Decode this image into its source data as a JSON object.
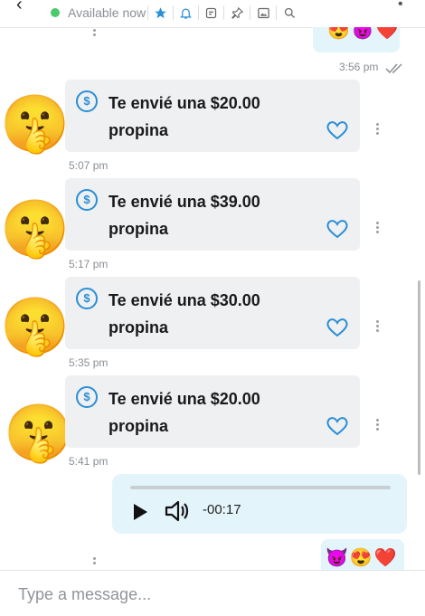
{
  "header": {
    "status": "Available now",
    "tools": [
      "star-icon",
      "bell-icon",
      "note-icon",
      "pin-icon",
      "image-icon",
      "search-icon"
    ],
    "status_color": "#4cc96a"
  },
  "chat": {
    "top_outgoing": {
      "emojis": "😍😈❤️",
      "time": "3:56 pm"
    },
    "tips": [
      {
        "text": "Te envié una $20.00 propina",
        "time": "5:07 pm",
        "avatar": "🤫"
      },
      {
        "text": "Te envié una $39.00 propina",
        "time": "5:17 pm",
        "avatar": "🤫"
      },
      {
        "text": "Te envié una $30.00 propina",
        "time": "5:35 pm",
        "avatar": "🤫"
      },
      {
        "text": "Te envié una $20.00 propina",
        "time": "5:41 pm",
        "avatar": "🤫"
      }
    ],
    "audio": {
      "duration": "-00:17"
    },
    "bottom_outgoing": {
      "emojis": "😈😍❤️"
    }
  },
  "composer": {
    "placeholder": "Type a message..."
  },
  "colors": {
    "accent": "#2a8fd6",
    "incoming_bubble": "#eff0f2",
    "outgoing_bubble": "#e3f4fb"
  }
}
